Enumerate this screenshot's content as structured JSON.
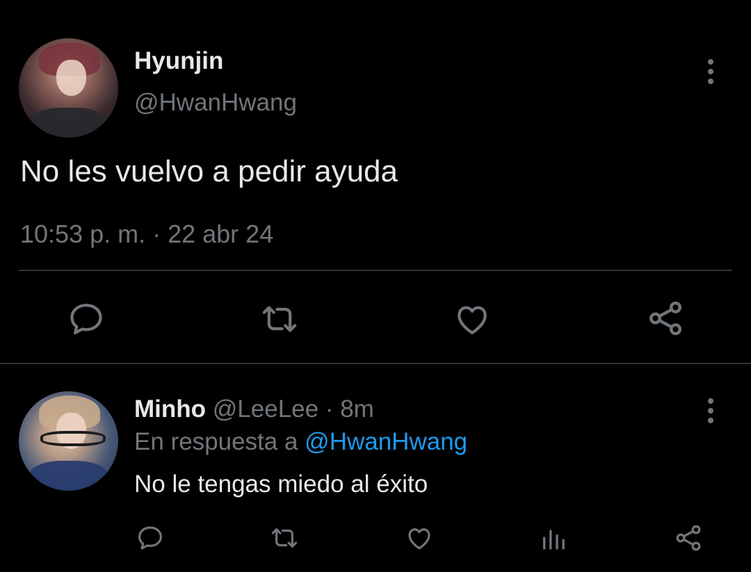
{
  "tweet": {
    "author_name": "Hyunjin",
    "author_handle": "@HwanHwang",
    "text": "No les vuelvo a pedir ayuda",
    "timestamp": "10:53 p. m. · 22 abr 24",
    "actions": [
      "reply-icon",
      "retweet-icon",
      "like-icon",
      "share-icon"
    ]
  },
  "reply": {
    "author_name": "Minho",
    "author_handle": "@LeeLee",
    "separator": "·",
    "time": "8m",
    "replying_to_prefix": "En respuesta a",
    "replying_to_handle": "@HwanHwang",
    "text": "No le tengas miedo al éxito",
    "actions": [
      "reply-icon",
      "retweet-icon",
      "like-icon",
      "views-icon",
      "share-icon"
    ]
  },
  "colors": {
    "background": "#000000",
    "text": "#e7e9ea",
    "secondary_text": "#71767b",
    "link": "#1d9bf0",
    "divider": "#2f3336"
  }
}
